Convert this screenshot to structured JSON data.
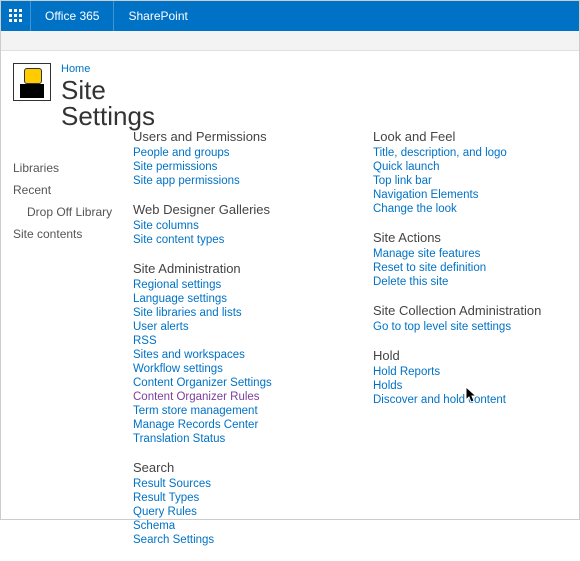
{
  "topbar": {
    "office": "Office 365",
    "sharepoint": "SharePoint"
  },
  "breadcrumb": "Home",
  "page_title": "Site Settings",
  "left_nav": {
    "libraries": "Libraries",
    "recent": "Recent",
    "drop_off": "Drop Off Library",
    "site_contents": "Site contents"
  },
  "col1": {
    "users_title": "Users and Permissions",
    "users_links": [
      "People and groups",
      "Site permissions",
      "Site app permissions"
    ],
    "wdg_title": "Web Designer Galleries",
    "wdg_links": [
      "Site columns",
      "Site content types"
    ],
    "admin_title": "Site Administration",
    "admin_links": [
      "Regional settings",
      "Language settings",
      "Site libraries and lists",
      "User alerts",
      "RSS",
      "Sites and workspaces",
      "Workflow settings",
      "Content Organizer Settings",
      "Content Organizer Rules",
      "Term store management",
      "Manage Records Center",
      "Translation Status"
    ],
    "search_title": "Search",
    "search_links": [
      "Result Sources",
      "Result Types",
      "Query Rules",
      "Schema",
      "Search Settings"
    ]
  },
  "col2": {
    "look_title": "Look and Feel",
    "look_links": [
      "Title, description, and logo",
      "Quick launch",
      "Top link bar",
      "Navigation Elements",
      "Change the look"
    ],
    "actions_title": "Site Actions",
    "actions_links": [
      "Manage site features",
      "Reset to site definition",
      "Delete this site"
    ],
    "sca_title": "Site Collection Administration",
    "sca_links": [
      "Go to top level site settings"
    ],
    "hold_title": "Hold",
    "hold_links": [
      "Hold Reports",
      "Holds",
      "Discover and hold content"
    ]
  },
  "visited_links": [
    "Content Organizer Rules"
  ]
}
